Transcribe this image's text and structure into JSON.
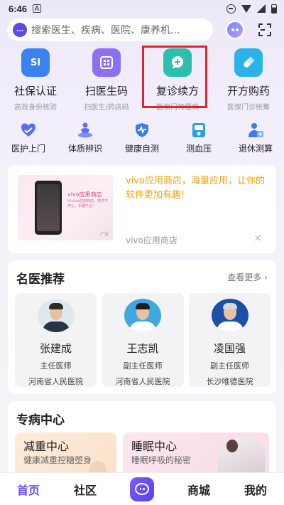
{
  "status_bar": {
    "time": "6:46",
    "notif_letter": "A"
  },
  "search": {
    "placeholder": "搜索医生、疾病、医院、康养机...",
    "logo_text": "...",
    "icon": "search-logo-icon"
  },
  "header_icons": [
    "assistant-avatar-icon",
    "scan-icon"
  ],
  "services": [
    {
      "title": "社保认证",
      "sub": "高效身份核验",
      "icon": "si-card-icon",
      "icon_text": "SI",
      "color": "#3b82f0"
    },
    {
      "title": "扫医生码",
      "sub": "扫医生/药店码",
      "icon": "qr-code-icon",
      "icon_text": "",
      "color": "#8d6ff2"
    },
    {
      "title": "复诊续方",
      "sub": "医保门特慢病",
      "icon": "chat-plus-icon",
      "icon_text": "+",
      "color": "#2dbfae"
    },
    {
      "title": "开方购药",
      "sub": "医保门诊统筹",
      "icon": "pill-icon",
      "icon_text": "",
      "color": "#29b3e6"
    }
  ],
  "tools": [
    {
      "label": "医护上门",
      "icon": "heart-hands-icon",
      "color": "#5b6cf5"
    },
    {
      "label": "体质辨识",
      "icon": "meditation-icon",
      "color": "#5b6cf5"
    },
    {
      "label": "健康自测",
      "icon": "shield-pulse-icon",
      "color": "#3b7cf0"
    },
    {
      "label": "测血压",
      "icon": "blood-pressure-icon",
      "color": "#29a3e6"
    },
    {
      "label": "退休测算",
      "icon": "person-calc-icon",
      "color": "#3b7cf0"
    }
  ],
  "ad": {
    "text": "vivo应用商店，海量应用，让你的软件更加有趣!",
    "source": "vivo应用商店",
    "close": "×",
    "thumb_title": "vivo应用商店",
    "thumb_text": "Hi,vivo应用商店，软件不停止，乐趣不止!",
    "thumb_mark": "广告"
  },
  "doctors_section": {
    "title": "名医推荐",
    "more": "查看更多 ›",
    "doctors": [
      {
        "name": "张建成",
        "title": "主任医师",
        "hospital": "河南省人民医院",
        "bg": "#dfe7ef",
        "hair": "#2b2b2b",
        "coat": "#2a3344"
      },
      {
        "name": "王志凯",
        "title": "副主任医师",
        "hospital": "河南省人民医院",
        "bg": "#3fa9df",
        "hair": "#1e1e1e",
        "coat": "#ffffff"
      },
      {
        "name": "凌国强",
        "title": "副主任医师",
        "hospital": "长沙唯德医院",
        "bg": "#1b4fa8",
        "hair": "#d8d8d8",
        "coat": "#ffffff"
      }
    ]
  },
  "special_section": {
    "title": "专病中心",
    "tiles": [
      {
        "title": "减重中心",
        "sub": "健康减重控糖塑身"
      },
      {
        "title": "睡眠中心",
        "sub": "睡眠呼吸的秘密"
      }
    ]
  },
  "tabbar": {
    "items": [
      "首页",
      "社区",
      "商城",
      "我的"
    ],
    "center_icon": "chat-bubble-icon",
    "active_color": "#6a4cf5"
  }
}
